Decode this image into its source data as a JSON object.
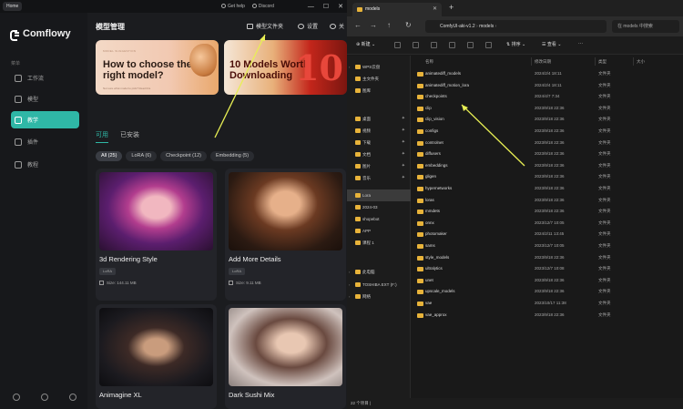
{
  "app": {
    "tab_title": "Home",
    "top_links": [
      "Get help",
      "Discord"
    ],
    "logo_text": "Comflowy",
    "section_label": "菜单",
    "nav": [
      "工作流",
      "模型",
      "教学",
      "插件",
      "教程"
    ],
    "page_title": "模型管理",
    "header_buttons": [
      "模型文件夹",
      "设置",
      "关"
    ],
    "banners": [
      {
        "small": "MODEL SUGGESTION",
        "title": "How to choose the right model?",
        "sub": "Not sure what model to pick? Read this"
      },
      {
        "title": "10 Models Worth Downloading",
        "number": "10"
      }
    ],
    "tabs": [
      "可用",
      "已安装"
    ],
    "filters": [
      "All (25)",
      "LoRA (6)",
      "Checkpoint (12)",
      "Embedding (5)"
    ],
    "cards": [
      {
        "name": "3d Rendering Style",
        "tag": "LoRA",
        "size": "Size: 144.11 MB"
      },
      {
        "name": "Add More Details",
        "tag": "LoRA",
        "size": "Size: 9.11 MB"
      },
      {
        "name": "Animagine XL",
        "tag": "",
        "size": ""
      },
      {
        "name": "Dark Sushi Mix",
        "tag": "",
        "size": ""
      }
    ]
  },
  "explorer": {
    "tab_title": "models",
    "address": [
      "ComfyUI-aki-v1.2",
      "models"
    ],
    "search_placeholder": "在 models 中搜索",
    "toolbar": {
      "new": "新建",
      "sort": "排序",
      "view": "查看"
    },
    "nav_items": [
      {
        "label": "WPS云盘",
        "chev": true
      },
      {
        "label": "主文件夹"
      },
      {
        "label": "图库"
      },
      {
        "label": "桌面",
        "pin": true
      },
      {
        "label": "视频",
        "pin": true
      },
      {
        "label": "下载",
        "pin": true
      },
      {
        "label": "文档",
        "pin": true
      },
      {
        "label": "图片",
        "pin": true
      },
      {
        "label": "音乐",
        "pin": true
      },
      {
        "label": "Lora",
        "sel": true
      },
      {
        "label": "2024-03"
      },
      {
        "label": "shopebot"
      },
      {
        "label": "APP"
      },
      {
        "label": "课程 1"
      },
      {
        "label": "此电脑",
        "chev": true
      },
      {
        "label": "TOSHIBA EXT (F:)",
        "chev": true
      },
      {
        "label": "网络",
        "chev": true
      }
    ],
    "columns": [
      "名称",
      "修改日期",
      "类型",
      "大小"
    ],
    "rows": [
      {
        "n": "animatediff_models",
        "d": "2024/2/4 18:11",
        "t": "文件夹"
      },
      {
        "n": "animatediff_motion_lora",
        "d": "2024/2/4 18:11",
        "t": "文件夹"
      },
      {
        "n": "checkpoints",
        "d": "2024/4/7 7:34",
        "t": "文件夹"
      },
      {
        "n": "clip",
        "d": "2023/9/18 22:36",
        "t": "文件夹"
      },
      {
        "n": "clip_vision",
        "d": "2023/9/18 22:36",
        "t": "文件夹"
      },
      {
        "n": "configs",
        "d": "2023/9/18 22:36",
        "t": "文件夹"
      },
      {
        "n": "controlnet",
        "d": "2023/9/18 22:36",
        "t": "文件夹"
      },
      {
        "n": "diffusers",
        "d": "2023/9/18 22:36",
        "t": "文件夹"
      },
      {
        "n": "embeddings",
        "d": "2023/9/18 22:36",
        "t": "文件夹"
      },
      {
        "n": "gligen",
        "d": "2023/9/18 22:36",
        "t": "文件夹"
      },
      {
        "n": "hypernetworks",
        "d": "2023/9/18 22:36",
        "t": "文件夹"
      },
      {
        "n": "loras",
        "d": "2023/9/18 22:36",
        "t": "文件夹"
      },
      {
        "n": "mmdets",
        "d": "2023/9/18 22:36",
        "t": "文件夹"
      },
      {
        "n": "onnx",
        "d": "2023/12/7 10:05",
        "t": "文件夹"
      },
      {
        "n": "photomaker",
        "d": "2024/2/11 13:45",
        "t": "文件夹"
      },
      {
        "n": "sams",
        "d": "2023/12/7 10:05",
        "t": "文件夹"
      },
      {
        "n": "style_models",
        "d": "2023/9/18 22:36",
        "t": "文件夹"
      },
      {
        "n": "ultralytics",
        "d": "2023/12/7 10:08",
        "t": "文件夹"
      },
      {
        "n": "unet",
        "d": "2023/9/18 22:36",
        "t": "文件夹"
      },
      {
        "n": "upscale_models",
        "d": "2023/9/18 22:36",
        "t": "文件夹"
      },
      {
        "n": "vae",
        "d": "2023/10/17 11:38",
        "t": "文件夹"
      },
      {
        "n": "vae_approx",
        "d": "2023/9/18 22:36",
        "t": "文件夹"
      }
    ],
    "status": "22 个项目 |"
  },
  "colors": {
    "accent": "#2fb7a6",
    "arrow": "#e8ef54",
    "folder": "#e8b33a"
  }
}
